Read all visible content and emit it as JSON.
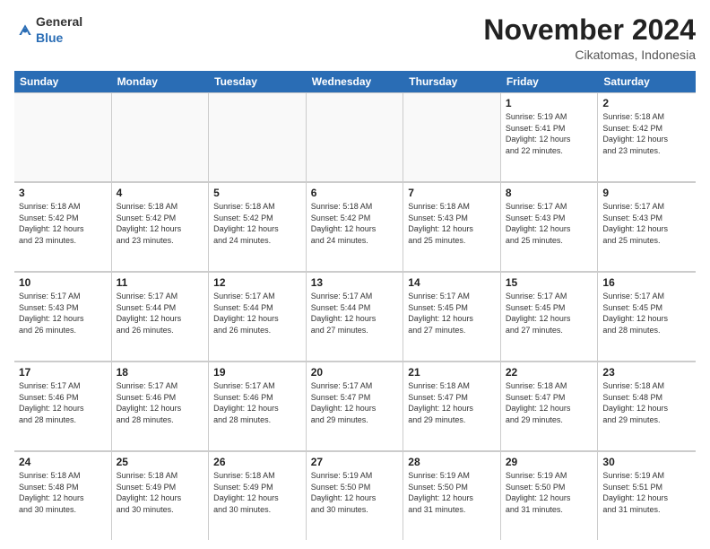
{
  "header": {
    "logo_general": "General",
    "logo_blue": "Blue",
    "month_year": "November 2024",
    "location": "Cikatomas, Indonesia"
  },
  "calendar": {
    "days_of_week": [
      "Sunday",
      "Monday",
      "Tuesday",
      "Wednesday",
      "Thursday",
      "Friday",
      "Saturday"
    ],
    "rows": [
      [
        {
          "day": "",
          "info": "",
          "empty": true
        },
        {
          "day": "",
          "info": "",
          "empty": true
        },
        {
          "day": "",
          "info": "",
          "empty": true
        },
        {
          "day": "",
          "info": "",
          "empty": true
        },
        {
          "day": "",
          "info": "",
          "empty": true
        },
        {
          "day": "1",
          "info": "Sunrise: 5:19 AM\nSunset: 5:41 PM\nDaylight: 12 hours\nand 22 minutes."
        },
        {
          "day": "2",
          "info": "Sunrise: 5:18 AM\nSunset: 5:42 PM\nDaylight: 12 hours\nand 23 minutes."
        }
      ],
      [
        {
          "day": "3",
          "info": "Sunrise: 5:18 AM\nSunset: 5:42 PM\nDaylight: 12 hours\nand 23 minutes."
        },
        {
          "day": "4",
          "info": "Sunrise: 5:18 AM\nSunset: 5:42 PM\nDaylight: 12 hours\nand 23 minutes."
        },
        {
          "day": "5",
          "info": "Sunrise: 5:18 AM\nSunset: 5:42 PM\nDaylight: 12 hours\nand 24 minutes."
        },
        {
          "day": "6",
          "info": "Sunrise: 5:18 AM\nSunset: 5:42 PM\nDaylight: 12 hours\nand 24 minutes."
        },
        {
          "day": "7",
          "info": "Sunrise: 5:18 AM\nSunset: 5:43 PM\nDaylight: 12 hours\nand 25 minutes."
        },
        {
          "day": "8",
          "info": "Sunrise: 5:17 AM\nSunset: 5:43 PM\nDaylight: 12 hours\nand 25 minutes."
        },
        {
          "day": "9",
          "info": "Sunrise: 5:17 AM\nSunset: 5:43 PM\nDaylight: 12 hours\nand 25 minutes."
        }
      ],
      [
        {
          "day": "10",
          "info": "Sunrise: 5:17 AM\nSunset: 5:43 PM\nDaylight: 12 hours\nand 26 minutes."
        },
        {
          "day": "11",
          "info": "Sunrise: 5:17 AM\nSunset: 5:44 PM\nDaylight: 12 hours\nand 26 minutes."
        },
        {
          "day": "12",
          "info": "Sunrise: 5:17 AM\nSunset: 5:44 PM\nDaylight: 12 hours\nand 26 minutes."
        },
        {
          "day": "13",
          "info": "Sunrise: 5:17 AM\nSunset: 5:44 PM\nDaylight: 12 hours\nand 27 minutes."
        },
        {
          "day": "14",
          "info": "Sunrise: 5:17 AM\nSunset: 5:45 PM\nDaylight: 12 hours\nand 27 minutes."
        },
        {
          "day": "15",
          "info": "Sunrise: 5:17 AM\nSunset: 5:45 PM\nDaylight: 12 hours\nand 27 minutes."
        },
        {
          "day": "16",
          "info": "Sunrise: 5:17 AM\nSunset: 5:45 PM\nDaylight: 12 hours\nand 28 minutes."
        }
      ],
      [
        {
          "day": "17",
          "info": "Sunrise: 5:17 AM\nSunset: 5:46 PM\nDaylight: 12 hours\nand 28 minutes."
        },
        {
          "day": "18",
          "info": "Sunrise: 5:17 AM\nSunset: 5:46 PM\nDaylight: 12 hours\nand 28 minutes."
        },
        {
          "day": "19",
          "info": "Sunrise: 5:17 AM\nSunset: 5:46 PM\nDaylight: 12 hours\nand 28 minutes."
        },
        {
          "day": "20",
          "info": "Sunrise: 5:17 AM\nSunset: 5:47 PM\nDaylight: 12 hours\nand 29 minutes."
        },
        {
          "day": "21",
          "info": "Sunrise: 5:18 AM\nSunset: 5:47 PM\nDaylight: 12 hours\nand 29 minutes."
        },
        {
          "day": "22",
          "info": "Sunrise: 5:18 AM\nSunset: 5:47 PM\nDaylight: 12 hours\nand 29 minutes."
        },
        {
          "day": "23",
          "info": "Sunrise: 5:18 AM\nSunset: 5:48 PM\nDaylight: 12 hours\nand 29 minutes."
        }
      ],
      [
        {
          "day": "24",
          "info": "Sunrise: 5:18 AM\nSunset: 5:48 PM\nDaylight: 12 hours\nand 30 minutes."
        },
        {
          "day": "25",
          "info": "Sunrise: 5:18 AM\nSunset: 5:49 PM\nDaylight: 12 hours\nand 30 minutes."
        },
        {
          "day": "26",
          "info": "Sunrise: 5:18 AM\nSunset: 5:49 PM\nDaylight: 12 hours\nand 30 minutes."
        },
        {
          "day": "27",
          "info": "Sunrise: 5:19 AM\nSunset: 5:50 PM\nDaylight: 12 hours\nand 30 minutes."
        },
        {
          "day": "28",
          "info": "Sunrise: 5:19 AM\nSunset: 5:50 PM\nDaylight: 12 hours\nand 31 minutes."
        },
        {
          "day": "29",
          "info": "Sunrise: 5:19 AM\nSunset: 5:50 PM\nDaylight: 12 hours\nand 31 minutes."
        },
        {
          "day": "30",
          "info": "Sunrise: 5:19 AM\nSunset: 5:51 PM\nDaylight: 12 hours\nand 31 minutes."
        }
      ]
    ]
  }
}
